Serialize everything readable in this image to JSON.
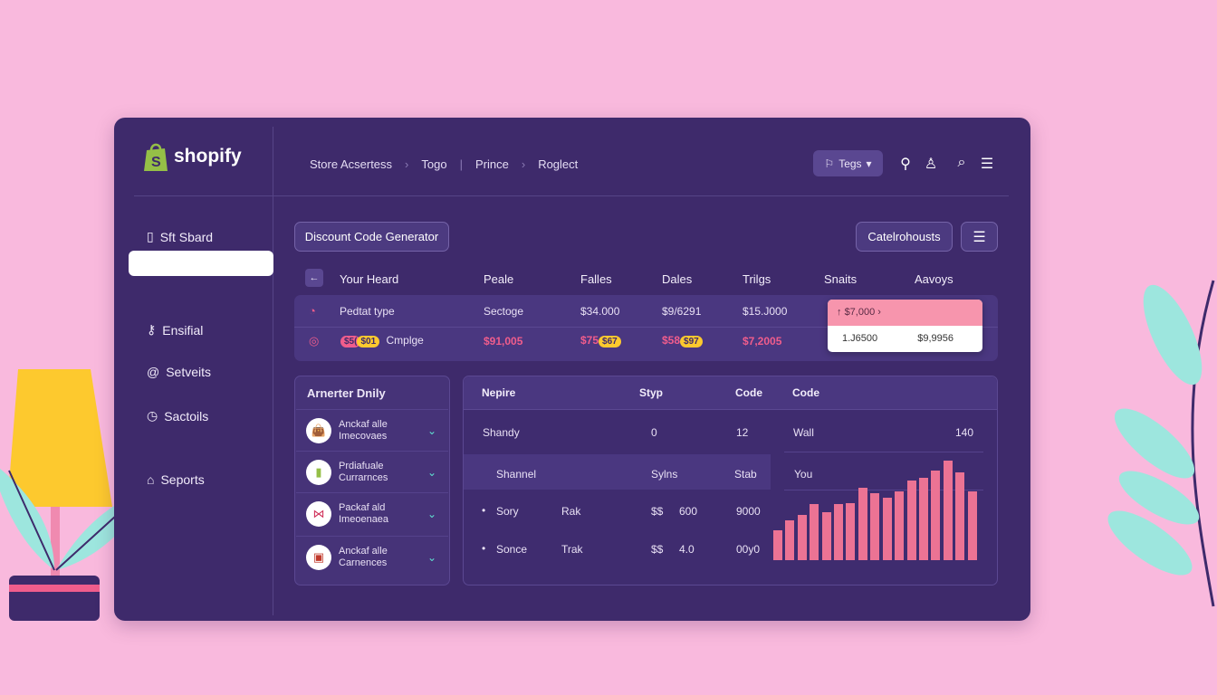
{
  "brand": {
    "name": "shopify",
    "color": "#95bf47"
  },
  "breadcrumb": [
    "Store Acsertess",
    "Togo",
    "Prince",
    "Roglect"
  ],
  "header": {
    "tags_label": "Tegs",
    "icons": [
      "pin-icon",
      "user-icon",
      "search-icon",
      "menu-icon"
    ]
  },
  "sidebar": {
    "items": [
      {
        "label": "Sft Sbard",
        "icon": "phone-icon"
      },
      {
        "label": "",
        "icon": ""
      },
      {
        "label": "Ensifial",
        "icon": "key-icon"
      },
      {
        "label": "Setveits",
        "icon": "at-icon"
      },
      {
        "label": "Sactoils",
        "icon": "clock-icon"
      },
      {
        "label": "Seports",
        "icon": "bag-icon"
      }
    ]
  },
  "main": {
    "title_button": "Discount Code Generator",
    "right_button": "Catelrohousts",
    "table": {
      "headers": [
        "Your Heard",
        "Peale",
        "Falles",
        "Dales",
        "Trilgs",
        "Snaits",
        "Aavoys"
      ],
      "rows": [
        {
          "name": "Pedtat type",
          "c1": "Sectoge",
          "c2": "$34.000",
          "c3": "$9/6291",
          "c4": "$15.J000"
        },
        {
          "chip1": "$5(",
          "chip2": "$01",
          "name": "Cmplge",
          "c1": "$91,005",
          "c2": "$75",
          "chip3": "$67",
          "c3": "$58",
          "chip4": "$97",
          "c4": "$7,2005"
        }
      ],
      "popup": {
        "top": "$7,000",
        "left": "1.J6500",
        "right": "$9,9956"
      }
    },
    "list": {
      "title": "Arnerter Dnily",
      "items": [
        {
          "line1": "Anckaf alle",
          "line2": "Imecovaes",
          "icon": "bag-icon"
        },
        {
          "line1": "Prdiafuale",
          "line2": "Currarnces",
          "icon": "shopify-bag-icon"
        },
        {
          "line1": "Packaf ald",
          "line2": "Imeoenaea",
          "icon": "ribbon-icon"
        },
        {
          "line1": "Anckaf alle",
          "line2": "Carnences",
          "icon": "box-icon"
        }
      ]
    },
    "details": {
      "headers": [
        "Nepire",
        "Styp",
        "Code",
        "Code"
      ],
      "row1": [
        "Shandy",
        "0",
        "12",
        "Wall",
        "140"
      ],
      "subheader": [
        "Shannel",
        "Sylns",
        "Stab",
        "You"
      ],
      "rows": [
        [
          "Sory",
          "Rak",
          "$$",
          "600",
          "9000"
        ],
        [
          "Sonce",
          "Trak",
          "$$",
          "4.0",
          "00y0"
        ]
      ]
    }
  },
  "chart_data": {
    "type": "bar",
    "values": [
      31,
      42,
      47,
      59,
      50,
      59,
      60,
      76,
      70,
      65,
      72,
      83,
      86,
      94,
      104,
      92,
      72
    ],
    "color": "#ec7394"
  }
}
